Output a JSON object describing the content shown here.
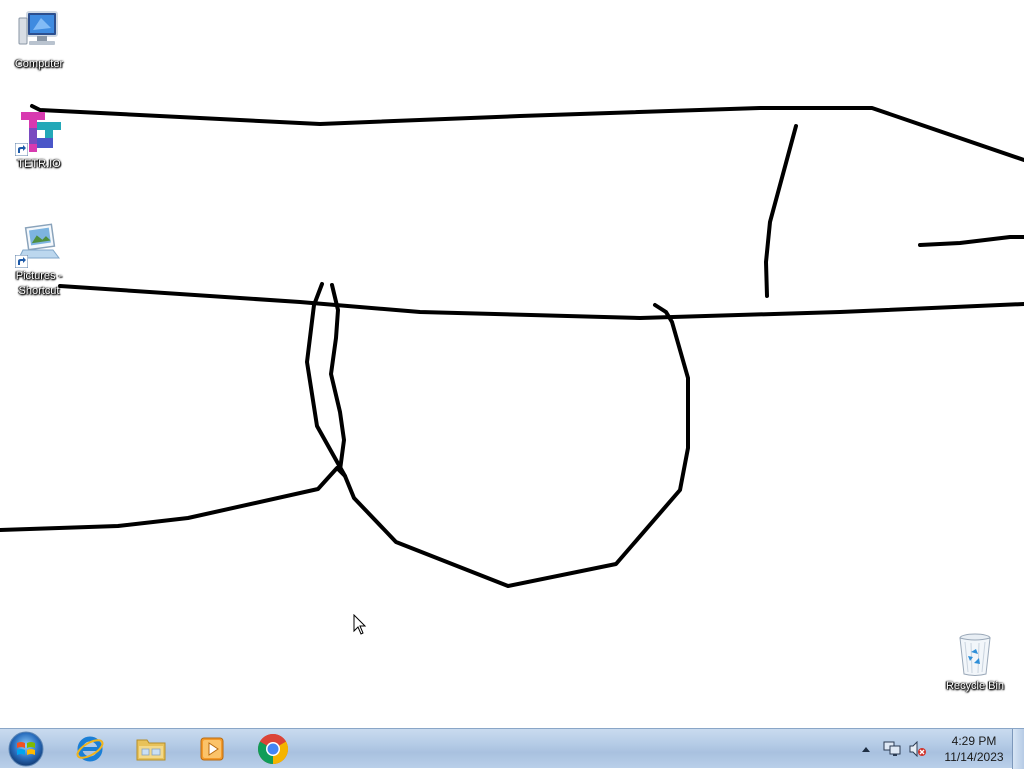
{
  "desktop": {
    "background_color": "#ffffff",
    "icons": [
      {
        "label": "Computer",
        "icon": "computer-icon"
      },
      {
        "label": "TETR.IO",
        "icon": "tetrio-icon"
      },
      {
        "label": "Pictures - Shortcut",
        "icon": "pictures-shortcut-icon"
      },
      {
        "label": "Recycle Bin",
        "icon": "recycle-bin-icon"
      }
    ],
    "drawing": {
      "stroke_color": "#000000",
      "description_icon": "freehand-drawing"
    }
  },
  "taskbar": {
    "start_icon": "windows-start-orb-icon",
    "pinned": [
      {
        "name": "Internet Explorer",
        "icon": "internet-explorer-icon"
      },
      {
        "name": "Windows Explorer",
        "icon": "file-explorer-icon"
      },
      {
        "name": "Windows Media Player",
        "icon": "media-player-icon"
      },
      {
        "name": "Google Chrome",
        "icon": "chrome-icon"
      }
    ],
    "tray": {
      "icons": [
        "show-hidden-icons-arrow-icon",
        "network-icon",
        "volume-muted-icon"
      ],
      "time": "4:29 PM",
      "date": "11/14/2023"
    }
  }
}
